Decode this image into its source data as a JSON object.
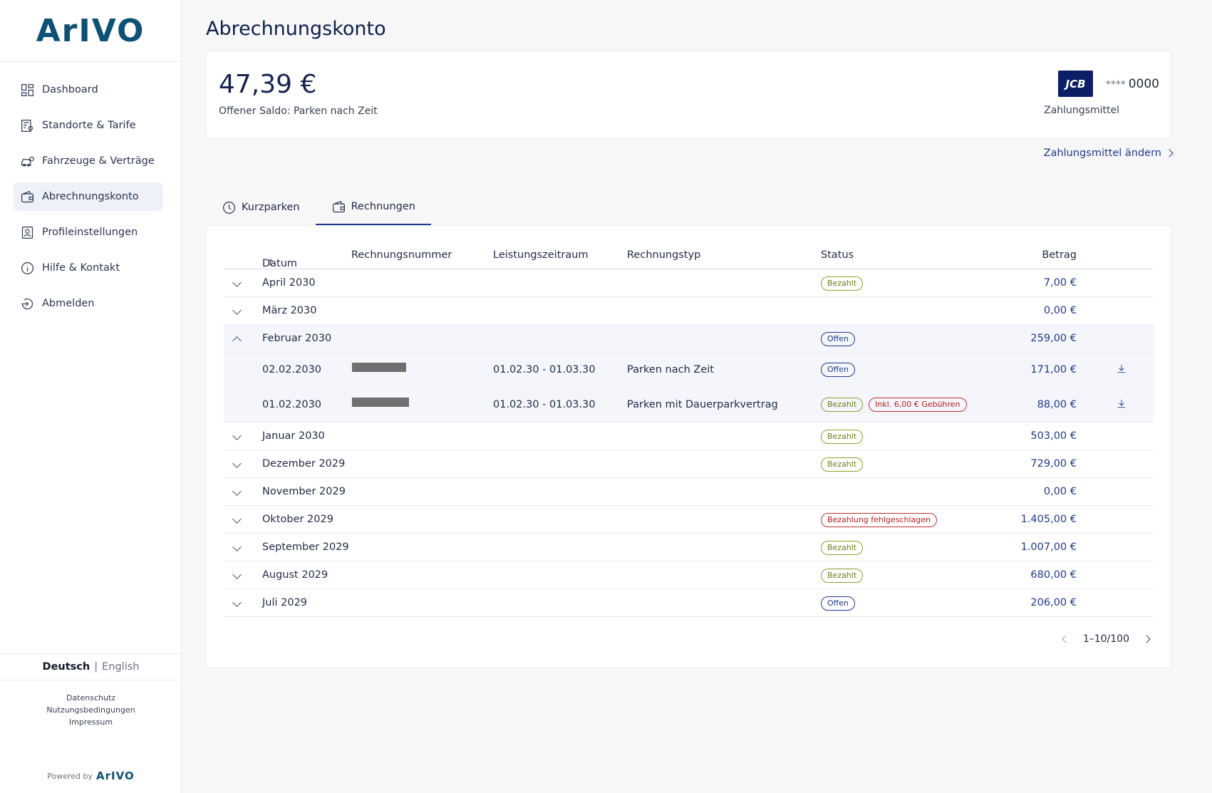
{
  "brand": {
    "logo": "ArIVO",
    "powered_by": "Powered by",
    "powered_logo": "ArIVO"
  },
  "nav": [
    {
      "label": "Dashboard",
      "icon": "dashboard-icon"
    },
    {
      "label": "Standorte & Tarife",
      "icon": "location-tariff-icon"
    },
    {
      "label": "Fahrzeuge & Verträge",
      "icon": "car-gear-icon"
    },
    {
      "label": "Abrechnungskonto",
      "icon": "wallet-icon",
      "active": true
    },
    {
      "label": "Profileinstellungen",
      "icon": "profile-icon"
    },
    {
      "label": "Hilfe & Kontakt",
      "icon": "info-icon"
    },
    {
      "label": "Abmelden",
      "icon": "logout-icon"
    }
  ],
  "lang": {
    "de": "Deutsch",
    "sep": "|",
    "en": "English"
  },
  "legal": {
    "privacy": "Datenschutz",
    "terms": "Nutzungsbedingungen",
    "imprint": "Impressum"
  },
  "page": {
    "title": "Abrechnungskonto"
  },
  "balance": {
    "amount": "47,39 €",
    "label": "Offener Saldo: Parken nach Zeit"
  },
  "payment": {
    "brand": "JCB",
    "stars": "****",
    "last4": "0000",
    "label": "Zahlungsmittel",
    "change": "Zahlungsmittel ändern"
  },
  "tabs": [
    {
      "label": "Kurzparken",
      "icon": "clock-icon"
    },
    {
      "label": "Rechnungen",
      "icon": "wallet-icon",
      "active": true
    }
  ],
  "table": {
    "headers": {
      "date": "Datum",
      "number": "Rechnungsnummer",
      "period": "Leistungszeitraum",
      "type": "Rechnungstyp",
      "status": "Status",
      "amount": "Betrag"
    },
    "rows": [
      {
        "month": "April 2030",
        "status": "Bezahlt",
        "amount": "7,00 €"
      },
      {
        "month": "März 2030",
        "status": "",
        "amount": "0,00 €"
      },
      {
        "month": "Februar 2030",
        "status": "Offen",
        "amount": "259,00 €"
      },
      {
        "date": "02.02.2030",
        "period": "01.02.30 - 01.03.30",
        "type": "Parken nach Zeit",
        "status": "Offen",
        "amount": "171,00 €"
      },
      {
        "date": "01.02.2030",
        "period": "01.02.30 - 01.03.30",
        "type": "Parken mit Dauerparkvertrag",
        "status": "Bezahlt",
        "extra": "Inkl. 6,00 € Gebühren",
        "amount": "88,00 €"
      },
      {
        "month": "Januar 2030",
        "status": "Bezahlt",
        "amount": "503,00 €"
      },
      {
        "month": "Dezember 2029",
        "status": "Bezahlt",
        "amount": "729,00 €"
      },
      {
        "month": "November 2029",
        "status": "",
        "amount": "0,00 €"
      },
      {
        "month": "Oktober 2029",
        "status": "Bezahlung fehlgeschlagen",
        "amount": "1.405,00 €"
      },
      {
        "month": "September 2029",
        "status": "Bezahlt",
        "amount": "1.007,00 €"
      },
      {
        "month": "August 2029",
        "status": "Bezahlt",
        "amount": "680,00 €"
      },
      {
        "month": "Juli 2029",
        "status": "Offen",
        "amount": "206,00 €"
      }
    ]
  },
  "pagination": {
    "range": "1–10/100"
  }
}
